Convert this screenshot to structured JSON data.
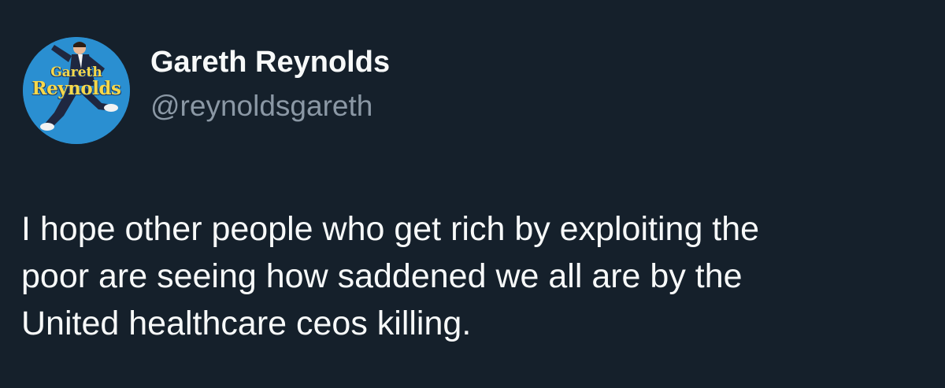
{
  "author": {
    "display_name": "Gareth Reynolds",
    "handle": "@reynoldsgareth",
    "avatar": {
      "line1": "Gareth",
      "line2": "Reynolds",
      "background_color": "#2a8fd1",
      "text_color": "#f6d84a"
    }
  },
  "tweet": {
    "lines": [
      "I hope other people who get rich by exploiting the",
      "poor are seeing how saddened we all are by the",
      "United healthcare ceos killing."
    ]
  },
  "theme": {
    "background": "#15202b",
    "primary_text": "#f7f9f9",
    "secondary_text": "#8b98a5"
  }
}
